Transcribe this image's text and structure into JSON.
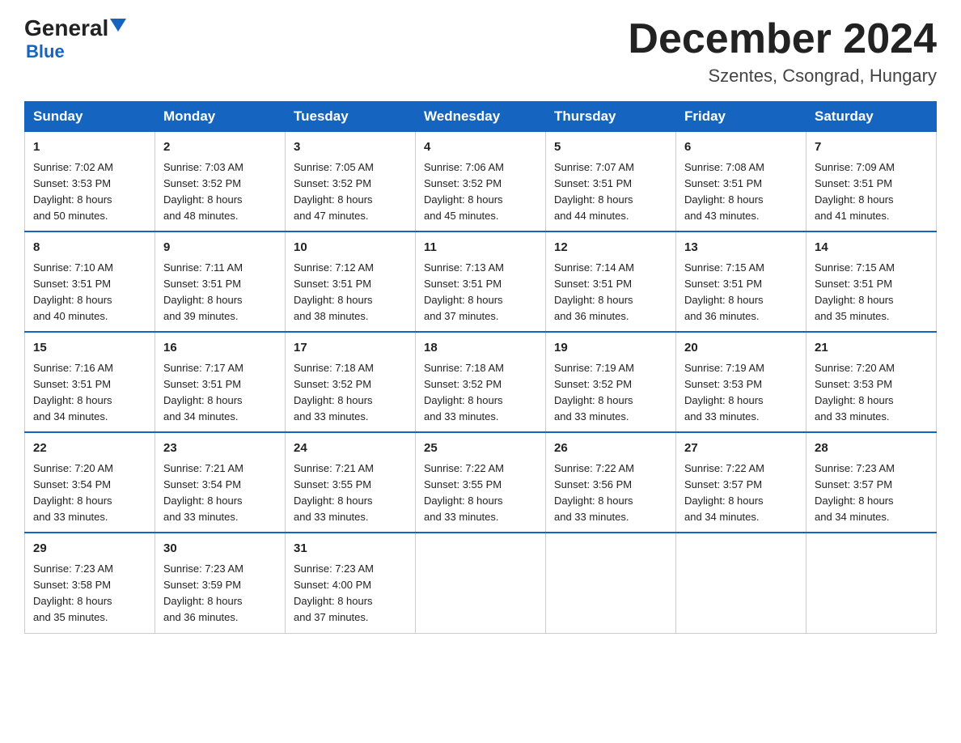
{
  "header": {
    "logo_general": "General",
    "logo_blue": "Blue",
    "month_title": "December 2024",
    "location": "Szentes, Csongrad, Hungary"
  },
  "days_of_week": [
    "Sunday",
    "Monday",
    "Tuesday",
    "Wednesday",
    "Thursday",
    "Friday",
    "Saturday"
  ],
  "weeks": [
    [
      {
        "day": "1",
        "sunrise": "7:02 AM",
        "sunset": "3:53 PM",
        "daylight": "8 hours and 50 minutes."
      },
      {
        "day": "2",
        "sunrise": "7:03 AM",
        "sunset": "3:52 PM",
        "daylight": "8 hours and 48 minutes."
      },
      {
        "day": "3",
        "sunrise": "7:05 AM",
        "sunset": "3:52 PM",
        "daylight": "8 hours and 47 minutes."
      },
      {
        "day": "4",
        "sunrise": "7:06 AM",
        "sunset": "3:52 PM",
        "daylight": "8 hours and 45 minutes."
      },
      {
        "day": "5",
        "sunrise": "7:07 AM",
        "sunset": "3:51 PM",
        "daylight": "8 hours and 44 minutes."
      },
      {
        "day": "6",
        "sunrise": "7:08 AM",
        "sunset": "3:51 PM",
        "daylight": "8 hours and 43 minutes."
      },
      {
        "day": "7",
        "sunrise": "7:09 AM",
        "sunset": "3:51 PM",
        "daylight": "8 hours and 41 minutes."
      }
    ],
    [
      {
        "day": "8",
        "sunrise": "7:10 AM",
        "sunset": "3:51 PM",
        "daylight": "8 hours and 40 minutes."
      },
      {
        "day": "9",
        "sunrise": "7:11 AM",
        "sunset": "3:51 PM",
        "daylight": "8 hours and 39 minutes."
      },
      {
        "day": "10",
        "sunrise": "7:12 AM",
        "sunset": "3:51 PM",
        "daylight": "8 hours and 38 minutes."
      },
      {
        "day": "11",
        "sunrise": "7:13 AM",
        "sunset": "3:51 PM",
        "daylight": "8 hours and 37 minutes."
      },
      {
        "day": "12",
        "sunrise": "7:14 AM",
        "sunset": "3:51 PM",
        "daylight": "8 hours and 36 minutes."
      },
      {
        "day": "13",
        "sunrise": "7:15 AM",
        "sunset": "3:51 PM",
        "daylight": "8 hours and 36 minutes."
      },
      {
        "day": "14",
        "sunrise": "7:15 AM",
        "sunset": "3:51 PM",
        "daylight": "8 hours and 35 minutes."
      }
    ],
    [
      {
        "day": "15",
        "sunrise": "7:16 AM",
        "sunset": "3:51 PM",
        "daylight": "8 hours and 34 minutes."
      },
      {
        "day": "16",
        "sunrise": "7:17 AM",
        "sunset": "3:51 PM",
        "daylight": "8 hours and 34 minutes."
      },
      {
        "day": "17",
        "sunrise": "7:18 AM",
        "sunset": "3:52 PM",
        "daylight": "8 hours and 33 minutes."
      },
      {
        "day": "18",
        "sunrise": "7:18 AM",
        "sunset": "3:52 PM",
        "daylight": "8 hours and 33 minutes."
      },
      {
        "day": "19",
        "sunrise": "7:19 AM",
        "sunset": "3:52 PM",
        "daylight": "8 hours and 33 minutes."
      },
      {
        "day": "20",
        "sunrise": "7:19 AM",
        "sunset": "3:53 PM",
        "daylight": "8 hours and 33 minutes."
      },
      {
        "day": "21",
        "sunrise": "7:20 AM",
        "sunset": "3:53 PM",
        "daylight": "8 hours and 33 minutes."
      }
    ],
    [
      {
        "day": "22",
        "sunrise": "7:20 AM",
        "sunset": "3:54 PM",
        "daylight": "8 hours and 33 minutes."
      },
      {
        "day": "23",
        "sunrise": "7:21 AM",
        "sunset": "3:54 PM",
        "daylight": "8 hours and 33 minutes."
      },
      {
        "day": "24",
        "sunrise": "7:21 AM",
        "sunset": "3:55 PM",
        "daylight": "8 hours and 33 minutes."
      },
      {
        "day": "25",
        "sunrise": "7:22 AM",
        "sunset": "3:55 PM",
        "daylight": "8 hours and 33 minutes."
      },
      {
        "day": "26",
        "sunrise": "7:22 AM",
        "sunset": "3:56 PM",
        "daylight": "8 hours and 33 minutes."
      },
      {
        "day": "27",
        "sunrise": "7:22 AM",
        "sunset": "3:57 PM",
        "daylight": "8 hours and 34 minutes."
      },
      {
        "day": "28",
        "sunrise": "7:23 AM",
        "sunset": "3:57 PM",
        "daylight": "8 hours and 34 minutes."
      }
    ],
    [
      {
        "day": "29",
        "sunrise": "7:23 AM",
        "sunset": "3:58 PM",
        "daylight": "8 hours and 35 minutes."
      },
      {
        "day": "30",
        "sunrise": "7:23 AM",
        "sunset": "3:59 PM",
        "daylight": "8 hours and 36 minutes."
      },
      {
        "day": "31",
        "sunrise": "7:23 AM",
        "sunset": "4:00 PM",
        "daylight": "8 hours and 37 minutes."
      },
      null,
      null,
      null,
      null
    ]
  ],
  "labels": {
    "sunrise": "Sunrise:",
    "sunset": "Sunset:",
    "daylight": "Daylight:"
  }
}
